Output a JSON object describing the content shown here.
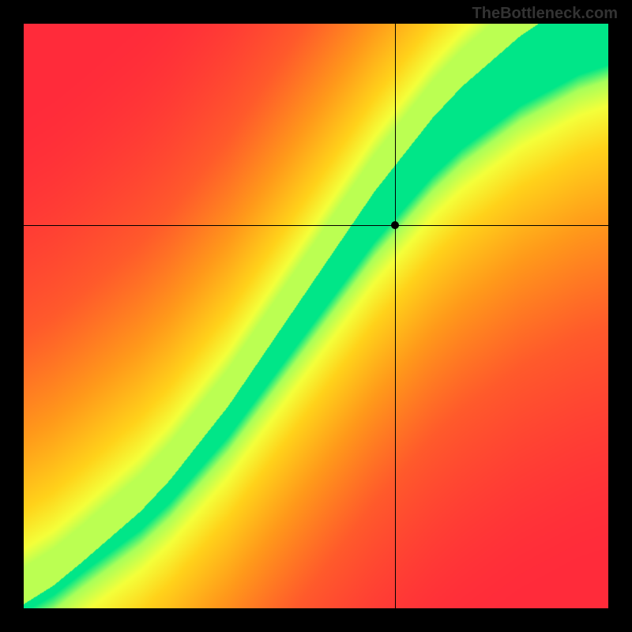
{
  "watermark": "TheBottleneck.com",
  "chart_data": {
    "type": "heatmap",
    "title": "",
    "xlabel": "",
    "ylabel": "",
    "xlim": [
      0,
      1
    ],
    "ylim": [
      0,
      1
    ],
    "crosshair": {
      "x": 0.635,
      "y": 0.655
    },
    "marker": {
      "x": 0.635,
      "y": 0.655
    },
    "optimal_curve": [
      {
        "x": 0.0,
        "y": 0.0
      },
      {
        "x": 0.05,
        "y": 0.03
      },
      {
        "x": 0.1,
        "y": 0.07
      },
      {
        "x": 0.15,
        "y": 0.11
      },
      {
        "x": 0.2,
        "y": 0.15
      },
      {
        "x": 0.25,
        "y": 0.2
      },
      {
        "x": 0.3,
        "y": 0.26
      },
      {
        "x": 0.35,
        "y": 0.32
      },
      {
        "x": 0.4,
        "y": 0.39
      },
      {
        "x": 0.45,
        "y": 0.46
      },
      {
        "x": 0.5,
        "y": 0.53
      },
      {
        "x": 0.55,
        "y": 0.6
      },
      {
        "x": 0.6,
        "y": 0.67
      },
      {
        "x": 0.65,
        "y": 0.73
      },
      {
        "x": 0.7,
        "y": 0.79
      },
      {
        "x": 0.75,
        "y": 0.84
      },
      {
        "x": 0.8,
        "y": 0.88
      },
      {
        "x": 0.85,
        "y": 0.92
      },
      {
        "x": 0.9,
        "y": 0.95
      },
      {
        "x": 0.95,
        "y": 0.98
      },
      {
        "x": 1.0,
        "y": 1.0
      }
    ],
    "band_width": [
      {
        "x": 0.0,
        "w": 0.015
      },
      {
        "x": 0.1,
        "w": 0.02
      },
      {
        "x": 0.2,
        "w": 0.035
      },
      {
        "x": 0.3,
        "w": 0.05
      },
      {
        "x": 0.4,
        "w": 0.065
      },
      {
        "x": 0.5,
        "w": 0.08
      },
      {
        "x": 0.6,
        "w": 0.095
      },
      {
        "x": 0.7,
        "w": 0.11
      },
      {
        "x": 0.8,
        "w": 0.125
      },
      {
        "x": 0.9,
        "w": 0.14
      },
      {
        "x": 1.0,
        "w": 0.155
      }
    ],
    "colorscale": [
      {
        "v": 0.0,
        "color": "#ff2b3a"
      },
      {
        "v": 0.3,
        "color": "#ff5a2b"
      },
      {
        "v": 0.55,
        "color": "#ff9a1a"
      },
      {
        "v": 0.75,
        "color": "#ffd21a"
      },
      {
        "v": 0.87,
        "color": "#f4ff3a"
      },
      {
        "v": 0.95,
        "color": "#a8ff5a"
      },
      {
        "v": 1.0,
        "color": "#00e688"
      }
    ]
  }
}
